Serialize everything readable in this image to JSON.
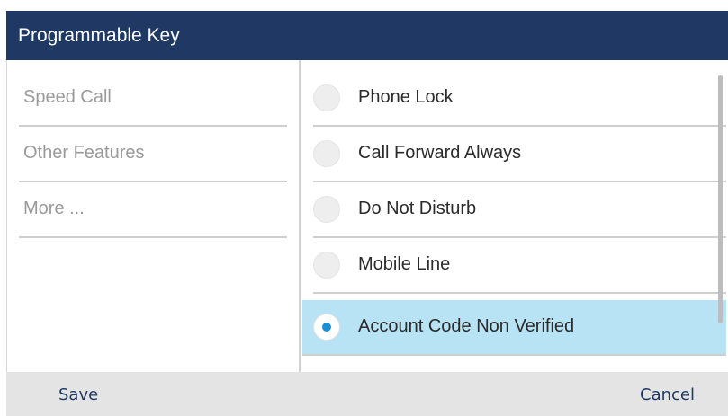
{
  "title": "Programmable Key",
  "categories": [
    {
      "label": "Speed Call"
    },
    {
      "label": "Other Features"
    },
    {
      "label": "More ..."
    }
  ],
  "options": [
    {
      "label": "Phone Lock",
      "selected": false
    },
    {
      "label": "Call Forward Always",
      "selected": false
    },
    {
      "label": "Do Not Disturb",
      "selected": false
    },
    {
      "label": "Mobile Line",
      "selected": false
    },
    {
      "label": "Account Code Non Verified",
      "selected": true
    }
  ],
  "softkeys": {
    "save_label": "Save",
    "cancel_label": "Cancel"
  },
  "colors": {
    "title_bar": "#1f3864",
    "selected_row": "#b7e3f5",
    "radio_dot": "#1a8fd6"
  }
}
